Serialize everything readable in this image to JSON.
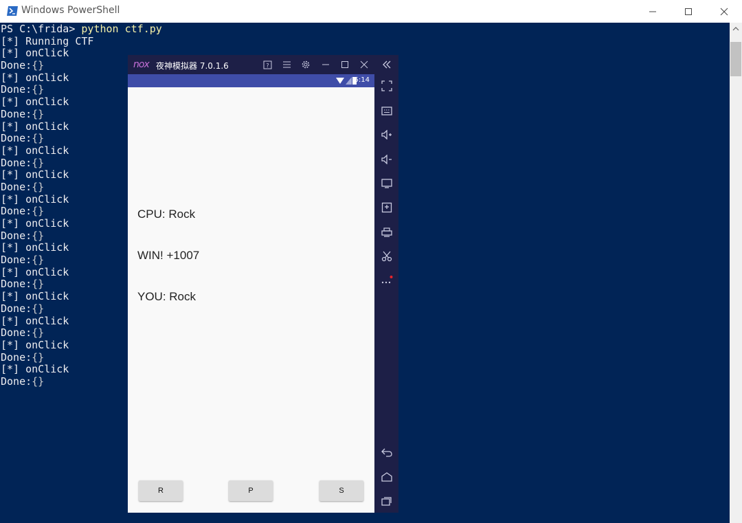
{
  "powershell": {
    "title": "Windows PowerShell",
    "lines": [
      {
        "prefix": "PS C:\\frida> ",
        "cmd": "python ctf.py",
        "suffix": ""
      },
      {
        "prefix": "[*] Running CTF",
        "cmd": "",
        "suffix": ""
      },
      {
        "prefix": "[*] onClick",
        "cmd": "",
        "suffix": ""
      },
      {
        "prefix": "Done:",
        "cmd": "",
        "suffix": "{}"
      },
      {
        "prefix": "[*] onClick",
        "cmd": "",
        "suffix": ""
      },
      {
        "prefix": "Done:",
        "cmd": "",
        "suffix": "{}"
      },
      {
        "prefix": "[*] onClick",
        "cmd": "",
        "suffix": ""
      },
      {
        "prefix": "Done:",
        "cmd": "",
        "suffix": "{}"
      },
      {
        "prefix": "[*] onClick",
        "cmd": "",
        "suffix": ""
      },
      {
        "prefix": "Done:",
        "cmd": "",
        "suffix": "{}"
      },
      {
        "prefix": "[*] onClick",
        "cmd": "",
        "suffix": ""
      },
      {
        "prefix": "Done:",
        "cmd": "",
        "suffix": "{}"
      },
      {
        "prefix": "[*] onClick",
        "cmd": "",
        "suffix": ""
      },
      {
        "prefix": "Done:",
        "cmd": "",
        "suffix": "{}"
      },
      {
        "prefix": "[*] onClick",
        "cmd": "",
        "suffix": ""
      },
      {
        "prefix": "Done:",
        "cmd": "",
        "suffix": "{}"
      },
      {
        "prefix": "[*] onClick",
        "cmd": "",
        "suffix": ""
      },
      {
        "prefix": "Done:",
        "cmd": "",
        "suffix": "{}"
      },
      {
        "prefix": "[*] onClick",
        "cmd": "",
        "suffix": ""
      },
      {
        "prefix": "Done:",
        "cmd": "",
        "suffix": "{}"
      },
      {
        "prefix": "[*] onClick",
        "cmd": "",
        "suffix": ""
      },
      {
        "prefix": "Done:",
        "cmd": "",
        "suffix": "{}"
      },
      {
        "prefix": "[*] onClick",
        "cmd": "",
        "suffix": ""
      },
      {
        "prefix": "Done:",
        "cmd": "",
        "suffix": "{}"
      },
      {
        "prefix": "[*] onClick",
        "cmd": "",
        "suffix": ""
      },
      {
        "prefix": "Done:",
        "cmd": "",
        "suffix": "{}"
      },
      {
        "prefix": "[*] onClick",
        "cmd": "",
        "suffix": ""
      },
      {
        "prefix": "Done:",
        "cmd": "",
        "suffix": "{}"
      },
      {
        "prefix": "[*] onClick",
        "cmd": "",
        "suffix": ""
      },
      {
        "prefix": "Done:",
        "cmd": "",
        "suffix": "{}"
      }
    ],
    "colors": {
      "background": "#012456",
      "text": "#eeedf0",
      "command": "#f5f0a8"
    }
  },
  "nox": {
    "logo": "nox",
    "title": "夜神模拟器 7.0.1.6",
    "status_time": "5:14",
    "app": {
      "cpu_text": "CPU: Rock",
      "result_text": "WIN! +1007",
      "you_text": "YOU: Rock",
      "buttons": [
        "R",
        "P",
        "S"
      ]
    },
    "sidebar_icons": [
      "fullscreen-icon",
      "keyboard-icon",
      "volume-up-icon",
      "volume-down-icon",
      "screen-icon",
      "add-apk-icon",
      "print-icon",
      "scissors-icon",
      "more-icon",
      "back-icon",
      "home-icon",
      "recents-icon"
    ],
    "colors": {
      "frame": "#1d1f47",
      "statusbar": "#3f4da8",
      "screen": "#f9f9f9"
    }
  }
}
